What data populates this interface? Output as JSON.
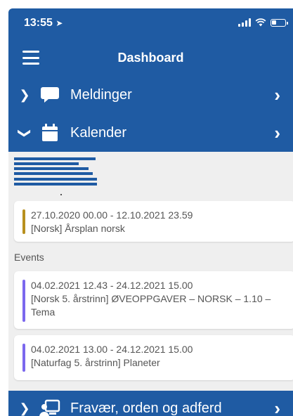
{
  "status": {
    "time": "13:55"
  },
  "header": {
    "title": "Dashboard"
  },
  "nav": [
    {
      "label": "Meldinger",
      "icon": "chat-bubble-icon",
      "state": "collapsed"
    },
    {
      "label": "Kalender",
      "icon": "calendar-icon",
      "state": "expanded"
    }
  ],
  "calendar": {
    "items": [
      {
        "dates": "27.10.2020 00.00 - 12.10.2021 23.59",
        "title": "[Norsk] Årsplan norsk",
        "color": "#b8901e"
      }
    ],
    "events_label": "Events",
    "events": [
      {
        "dates": "04.02.2021 12.43 - 24.12.2021 15.00",
        "title": "[Norsk 5. årstrinn] ØVEOPPGAVER – NORSK – 1.10 – Tema",
        "color": "#7b68ee"
      },
      {
        "dates": "04.02.2021 13.00 - 24.12.2021 15.00",
        "title": "[Naturfag 5. årstrinn] Planeter",
        "color": "#7b68ee"
      }
    ]
  },
  "bottom_nav": {
    "label": "Fravær, orden og adferd",
    "icon": "person-board-icon"
  },
  "colors": {
    "primary": "#1f5ba3",
    "background": "#efefef"
  }
}
